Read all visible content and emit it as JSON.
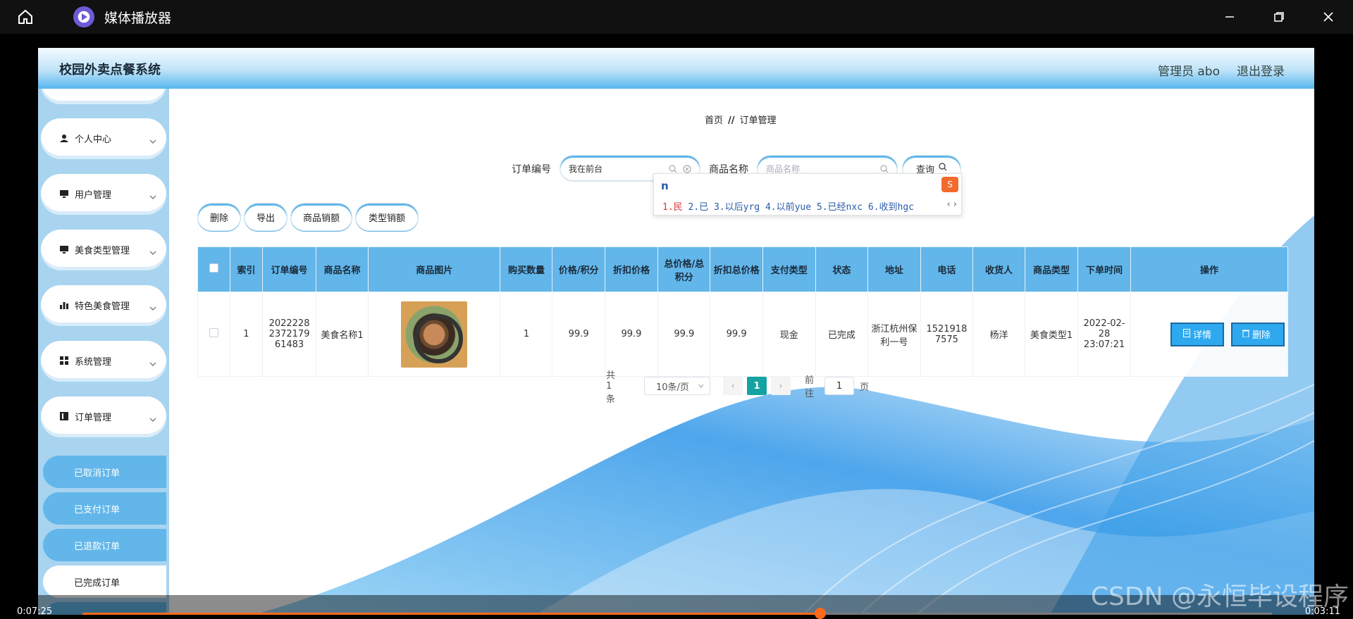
{
  "player": {
    "title": "媒体播放器",
    "time_elapsed": "0:07:25",
    "time_total": "0:03:11",
    "progress": 0.62,
    "watermark": "CSDN @永恒毕设程序"
  },
  "app": {
    "title": "校园外卖点餐系统",
    "admin_label": "管理员 abo",
    "logout": "退出登录"
  },
  "sidebar": {
    "menus": [
      {
        "label": "个人中心",
        "icon": "user-icon"
      },
      {
        "label": "用户管理",
        "icon": "monitor-icon"
      },
      {
        "label": "美食类型管理",
        "icon": "monitor-icon"
      },
      {
        "label": "特色美食管理",
        "icon": "bar-chart-icon"
      },
      {
        "label": "系统管理",
        "icon": "grid-icon"
      },
      {
        "label": "订单管理",
        "icon": "book-icon"
      }
    ],
    "submenus": [
      {
        "label": "已取消订单",
        "active": true
      },
      {
        "label": "已支付订单",
        "active": true
      },
      {
        "label": "已退款订单",
        "active": true
      },
      {
        "label": "已完成订单",
        "active": false
      }
    ]
  },
  "breadcrumb": {
    "home": "首页",
    "sep": "//",
    "current": "订单管理"
  },
  "search": {
    "order_label": "订单编号",
    "order_value": "我在前台",
    "product_label": "商品名称",
    "product_placeholder": "商品名称",
    "query_label": "查询"
  },
  "ime": {
    "input": "n",
    "candidates": [
      "1.民",
      "2.已",
      "3.以后yrg",
      "4.以前yue",
      "5.已经nxc",
      "6.收到hgc"
    ]
  },
  "actions": {
    "delete": "删除",
    "export": "导出",
    "sales_amount": "商品销额",
    "type_sales": "类型销额"
  },
  "table": {
    "headers": [
      "索引",
      "订单编号",
      "商品名称",
      "商品图片",
      "购买数量",
      "价格/积分",
      "折扣价格",
      "总价格/总积分",
      "折扣总价格",
      "支付类型",
      "状态",
      "地址",
      "电话",
      "收货人",
      "商品类型",
      "下单时间",
      "操作"
    ],
    "rows": [
      {
        "index": "1",
        "order_no": "2022228 2372179 61483",
        "product_name": "美食名称1",
        "qty": "1",
        "price": "99.9",
        "discount_price": "99.9",
        "total": "99.9",
        "discount_total": "99.9",
        "pay_type": "现金",
        "status": "已完成",
        "address": "浙江杭州保利一号",
        "phone": "15219187575",
        "receiver": "杨洋",
        "product_type": "美食类型1",
        "order_time": "2022-02-28 23:07:21",
        "detail": "详情",
        "delete": "删除"
      }
    ]
  },
  "pagination": {
    "total": "共 1 条",
    "page_size": "10条/页",
    "current": "1",
    "goto_prefix": "前往",
    "goto_value": "1",
    "goto_suffix": "页"
  },
  "colors": {
    "accent": "#62b6ea",
    "pager_active": "#14a3a0",
    "progress": "#ff6a1a"
  }
}
